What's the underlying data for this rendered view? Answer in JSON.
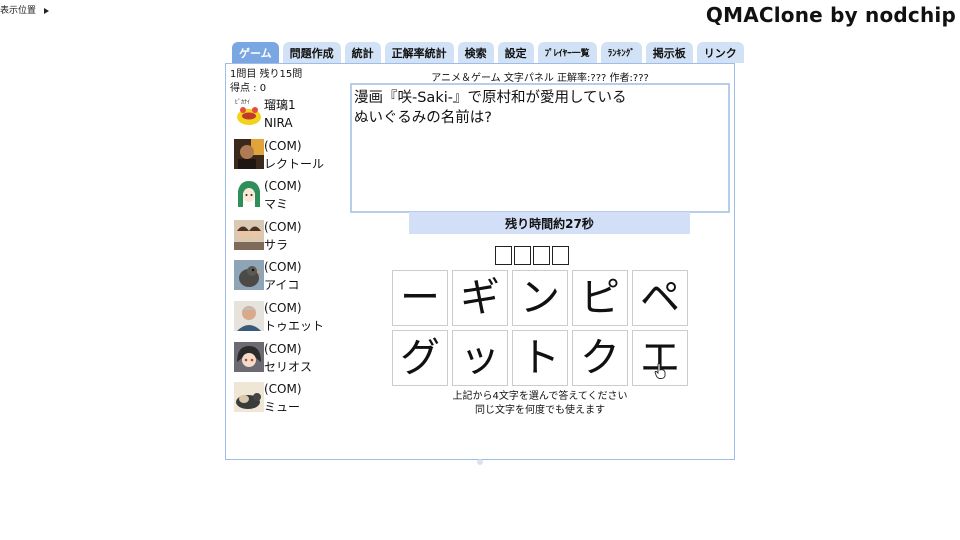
{
  "top": {
    "position_toggle_label": "表示位置",
    "app_title": "QMAClone by nodchip"
  },
  "tabs": [
    {
      "label": "ゲーム",
      "active": true
    },
    {
      "label": "問題作成"
    },
    {
      "label": "統計"
    },
    {
      "label": "正解率統計"
    },
    {
      "label": "検索"
    },
    {
      "label": "設定"
    },
    {
      "label": "ﾌﾟﾚｲﾔｰ一覧"
    },
    {
      "label": "ﾗﾝｷﾝｸﾞ"
    },
    {
      "label": "掲示板"
    },
    {
      "label": "リンク"
    }
  ],
  "game": {
    "question_progress": "1問目 残り15問",
    "score": "得点 : 0",
    "header": "アニメ＆ゲーム 文字パネル 正解率:??? 作者:???",
    "question_text": "漫画『咲-Saki-』で原村和が愛用している\nぬいぐるみの名前は?",
    "timer": "残り時間約27秒",
    "answer_slots": 4,
    "panels": [
      "ー",
      "ギ",
      "ン",
      "ピ",
      "ペ",
      "グ",
      "ッ",
      "ト",
      "ク",
      "エ"
    ],
    "instruction_line1": "上記から4文字を選んで答えてください",
    "instruction_line2": "同じ文字を何度でも使えます"
  },
  "players": [
    {
      "line1": "瑠璃1",
      "line2": "NIRA",
      "avatar": "cartoon-emblem-avatar"
    },
    {
      "line1": "(COM)",
      "line2": "レクトール",
      "avatar": "photo-avatar"
    },
    {
      "line1": "(COM)",
      "line2": "マミ",
      "avatar": "anime-girl-avatar"
    },
    {
      "line1": "(COM)",
      "line2": "サラ",
      "avatar": "photo-avatar"
    },
    {
      "line1": "(COM)",
      "line2": "アイコ",
      "avatar": "bird-photo-avatar"
    },
    {
      "line1": "(COM)",
      "line2": "トゥエット",
      "avatar": "person-photo-avatar"
    },
    {
      "line1": "(COM)",
      "line2": "セリオス",
      "avatar": "anime-character-avatar"
    },
    {
      "line1": "(COM)",
      "line2": "ミュー",
      "avatar": "cat-photo-avatar"
    }
  ],
  "colors": {
    "tab_active": "#7aa6e2",
    "tab_inactive": "#d2e2f6",
    "panel_border": "#9fbde6",
    "timer_bg": "#d2dff7"
  }
}
